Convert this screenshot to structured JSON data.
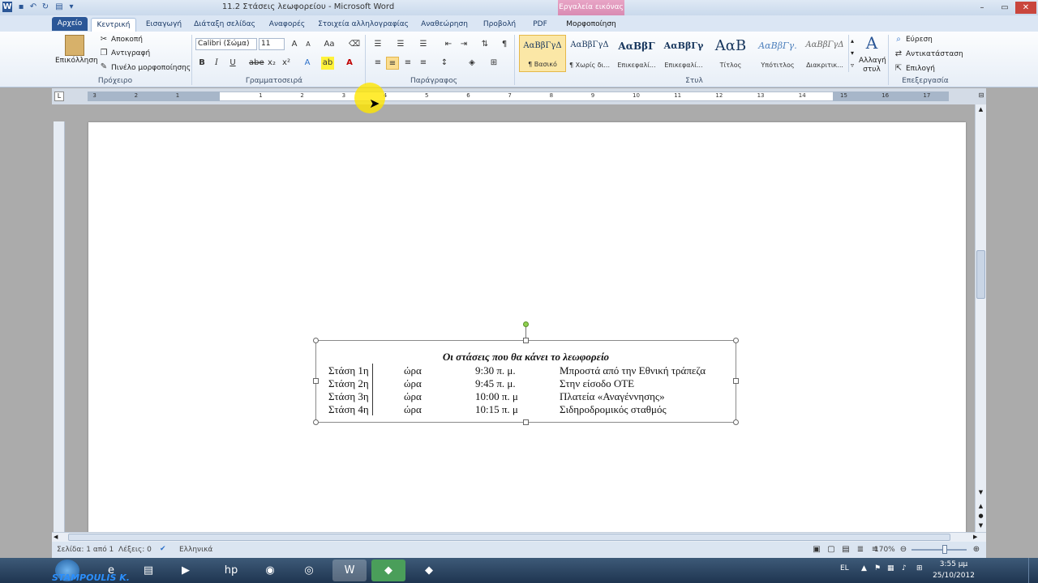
{
  "window": {
    "title": "11.2 Στάσεις λεωφορείου - Microsoft Word",
    "context_tool": "Εργαλεία εικόνας"
  },
  "tabs": [
    {
      "label": "Αρχείο"
    },
    {
      "label": "Κεντρική"
    },
    {
      "label": "Εισαγωγή"
    },
    {
      "label": "Διάταξη σελίδας"
    },
    {
      "label": "Αναφορές"
    },
    {
      "label": "Στοιχεία αλληλογραφίας"
    },
    {
      "label": "Αναθεώρηση"
    },
    {
      "label": "Προβολή"
    },
    {
      "label": "PDF"
    },
    {
      "label": "Μορφοποίηση"
    }
  ],
  "clipboard": {
    "paste": "Επικόλληση",
    "cut": "Αποκοπή",
    "copy": "Αντιγραφή",
    "format_painter": "Πινέλο μορφοποίησης",
    "label": "Πρόχειρο"
  },
  "font": {
    "name": "Calibri (Σώμα)",
    "size": "11",
    "label": "Γραμματοσειρά"
  },
  "paragraph": {
    "label": "Παράγραφος"
  },
  "styles": {
    "items": [
      {
        "sample": "ΑαΒβΓγΔ",
        "name": "¶ Βασικό"
      },
      {
        "sample": "ΑαΒβΓγΔ",
        "name": "¶ Χωρίς δι..."
      },
      {
        "sample": "ΑαΒβΓ",
        "name": "Επικεφαλί..."
      },
      {
        "sample": "ΑαΒβΓγ",
        "name": "Επικεφαλί..."
      },
      {
        "sample": "ΑαΒ",
        "name": "Τίτλος"
      },
      {
        "sample": "ΑαΒβΓγ.",
        "name": "Υπότιτλος"
      },
      {
        "sample": "ΑαΒβΓγΔ",
        "name": "Διακριτικ..."
      }
    ],
    "change_styles": "Αλλαγή στυλ",
    "label": "Στυλ"
  },
  "editing": {
    "find": "Εύρεση",
    "replace": "Αντικατάσταση",
    "select": "Επιλογή",
    "label": "Επεξεργασία"
  },
  "textbox": {
    "title": "Οι στάσεις που θα κάνει το λεωφορείο",
    "rows": [
      {
        "stop": "Στάση 1η",
        "label": "ώρα",
        "time": "9:30 π. μ.",
        "place": "Μπροστά από την Εθνική τράπεζα"
      },
      {
        "stop": "Στάση 2η",
        "label": "ώρα",
        "time": "9:45 π. μ.",
        "place": "Στην είσοδο ΟΤΕ"
      },
      {
        "stop": "Στάση 3η",
        "label": "ώρα",
        "time": "10:00 π. μ",
        "place": "Πλατεία «Αναγέννησης»"
      },
      {
        "stop": "Στάση 4η",
        "label": "ώρα",
        "time": "10:15 π. μ",
        "place": "Σιδηροδρομικός σταθμός"
      }
    ]
  },
  "ruler": {
    "marks": [
      "3",
      "2",
      "1",
      "1",
      "2",
      "3",
      "4",
      "5",
      "6",
      "7",
      "8",
      "9",
      "10",
      "11",
      "12",
      "13",
      "14",
      "15",
      "16",
      "17"
    ]
  },
  "status": {
    "page": "Σελίδα: 1 από 1",
    "words": "Λέξεις: 0",
    "language": "Ελληνικά",
    "zoom": "170%"
  },
  "taskbar": {
    "lang": "EL",
    "time": "3:55 μμ",
    "date": "25/10/2012",
    "watermark": "STAMPOULIS K."
  }
}
